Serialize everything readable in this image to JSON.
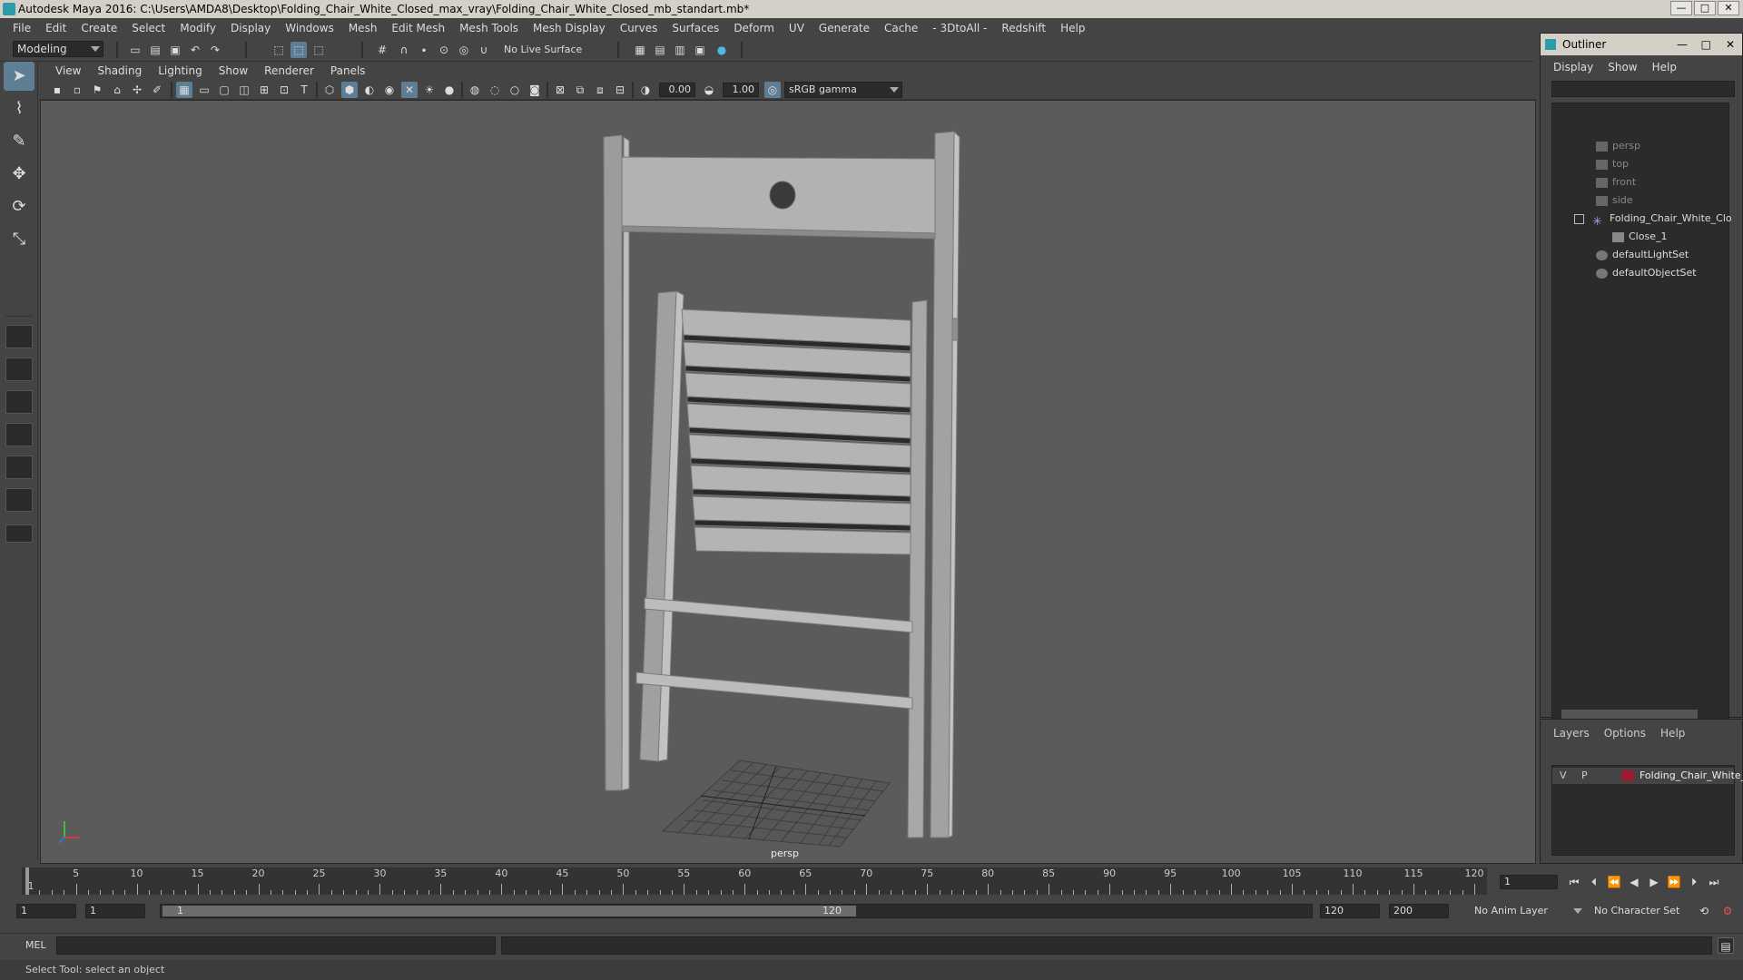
{
  "window": {
    "title": "Autodesk Maya 2016: C:\\Users\\AMDA8\\Desktop\\Folding_Chair_White_Closed_max_vray\\Folding_Chair_White_Closed_mb_standart.mb*",
    "controls": [
      "—",
      "□",
      "✕"
    ]
  },
  "menubar": [
    "File",
    "Edit",
    "Create",
    "Select",
    "Modify",
    "Display",
    "Windows",
    "Mesh",
    "Edit Mesh",
    "Mesh Tools",
    "Mesh Display",
    "Curves",
    "Surfaces",
    "Deform",
    "UV",
    "Generate",
    "Cache",
    "- 3DtoAll -",
    "Redshift",
    "Help"
  ],
  "statusline": {
    "mode": "Modeling",
    "live_surface": "No Live Surface"
  },
  "panel": {
    "menus": [
      "View",
      "Shading",
      "Lighting",
      "Show",
      "Renderer",
      "Panels"
    ],
    "exposure": "0.00",
    "gamma": "1.00",
    "color_space": "sRGB gamma"
  },
  "viewport": {
    "camera_label": "persp"
  },
  "outliner": {
    "title": "Outliner",
    "menus": [
      "Display",
      "Show",
      "Help"
    ],
    "items": [
      {
        "label": "persp",
        "icon": "camera-icon",
        "dim": true
      },
      {
        "label": "top",
        "icon": "camera-icon",
        "dim": true
      },
      {
        "label": "front",
        "icon": "camera-icon",
        "dim": true
      },
      {
        "label": "side",
        "icon": "camera-icon",
        "dim": true
      },
      {
        "label": "Folding_Chair_White_Clo",
        "icon": "group-icon",
        "dim": false
      },
      {
        "label": "Close_1",
        "icon": "mesh-icon",
        "dim": false
      },
      {
        "label": "defaultLightSet",
        "icon": "set-icon",
        "dim": false
      },
      {
        "label": "defaultObjectSet",
        "icon": "set-icon",
        "dim": false
      }
    ]
  },
  "layers": {
    "menus": [
      "Layers",
      "Options",
      "Help"
    ],
    "layer": {
      "v": "V",
      "p": "P",
      "name": "Folding_Chair_White_",
      "color": "#9b1b30"
    }
  },
  "timeline": {
    "ticks": [
      "1",
      "5",
      "10",
      "15",
      "20",
      "25",
      "30",
      "35",
      "40",
      "45",
      "50",
      "55",
      "60",
      "65",
      "70",
      "75",
      "80",
      "85",
      "90",
      "95",
      "100",
      "105",
      "110",
      "115",
      "120"
    ],
    "current_frame": "1"
  },
  "range": {
    "start": "1",
    "playback_start": "1",
    "slider_start": "1",
    "slider_end": "120",
    "playback_end": "120",
    "end": "200",
    "anim_layer": "No Anim Layer",
    "character_set": "No Character Set"
  },
  "cmdline": {
    "label": "MEL"
  },
  "helpline": {
    "text": "Select Tool: select an object"
  }
}
